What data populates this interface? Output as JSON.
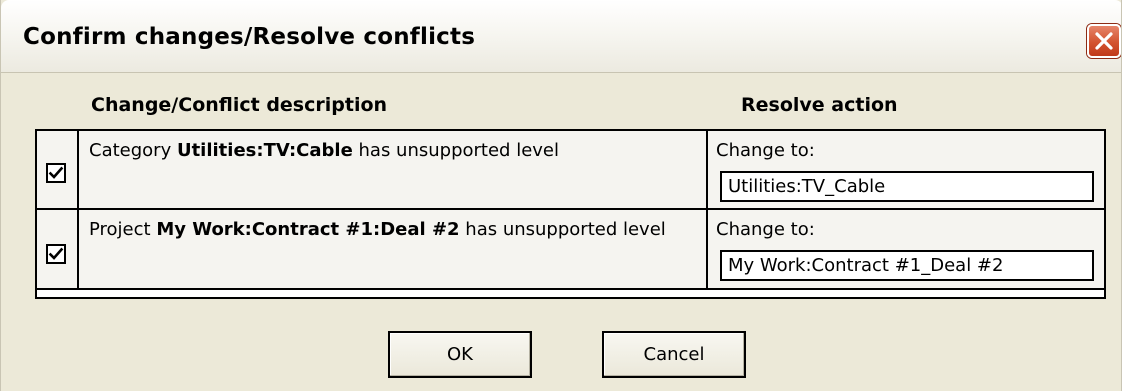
{
  "window": {
    "title": "Confirm changes/Resolve conflicts",
    "close_icon": "close-icon"
  },
  "headers": {
    "description": "Change/Conflict description",
    "action": "Resolve action"
  },
  "rows": [
    {
      "checked": true,
      "desc_prefix": "Category ",
      "desc_bold": "Utilities:TV:Cable",
      "desc_suffix": " has unsupported level",
      "action_label": "Change to:",
      "action_value": "Utilities:TV_Cable"
    },
    {
      "checked": true,
      "desc_prefix": "Project ",
      "desc_bold": "My Work:Contract #1:Deal #2",
      "desc_suffix": " has unsupported level",
      "action_label": "Change to:",
      "action_value": "My Work:Contract #1_Deal #2"
    }
  ],
  "buttons": {
    "ok": "OK",
    "cancel": "Cancel"
  },
  "colors": {
    "dialog_bg": "#ece9d8",
    "close_red": "#d3532f",
    "border": "#000000"
  }
}
